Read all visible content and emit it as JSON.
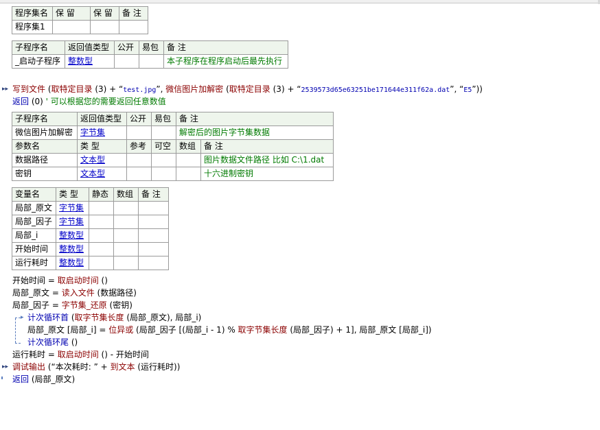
{
  "assembly_table": {
    "headers": [
      "程序集名",
      "保 留",
      "保 留",
      "备 注"
    ],
    "row": [
      "程序集1",
      "",
      "",
      ""
    ]
  },
  "startup_sub_table": {
    "headers": [
      "子程序名",
      "返回值类型",
      "公开",
      "易包",
      "备 注"
    ],
    "row": [
      "_启动子程序",
      "整数型",
      "",
      "",
      "本子程序在程序启动后最先执行"
    ]
  },
  "startup_code": {
    "line1": {
      "p1": "写到文件",
      "p2": " (",
      "p3": "取特定目录",
      "p4": " (3) + “",
      "p5": "test.jpg",
      "p6": "”, ",
      "p7": "微信图片加解密",
      "p8": " (",
      "p9": "取特定目录",
      "p10": " (3) + “",
      "p11": "2539573d65e63251be171644e311f62a.dat",
      "p12": "”, “",
      "p13": "E5",
      "p14": "”))"
    },
    "line2": {
      "p1": "返回",
      "p2": " (0)  ",
      "p3": "' 可以根据您的需要返回任意数值"
    }
  },
  "decrypt_sub_table": {
    "headers": [
      "子程序名",
      "返回值类型",
      "公开",
      "易包",
      "备 注"
    ],
    "row": [
      "微信图片加解密",
      "字节集",
      "",
      "",
      "解密后的图片字节集数据"
    ],
    "param_headers": [
      "参数名",
      "类 型",
      "参考",
      "可空",
      "数组",
      "备 注"
    ],
    "params": [
      [
        "数据路径",
        "文本型",
        "",
        "",
        "",
        "图片数据文件路径 比如 C:\\1.dat"
      ],
      [
        "密钥",
        "文本型",
        "",
        "",
        "",
        "十六进制密钥"
      ]
    ]
  },
  "locals_table": {
    "headers": [
      "变量名",
      "类 型",
      "静态",
      "数组",
      "备 注"
    ],
    "rows": [
      [
        "局部_原文",
        "字节集",
        "",
        "",
        ""
      ],
      [
        "局部_因子",
        "字节集",
        "",
        "",
        ""
      ],
      [
        "局部_i",
        "整数型",
        "",
        "",
        ""
      ],
      [
        "开始时间",
        "整数型",
        "",
        "",
        ""
      ],
      [
        "运行耗时",
        "整数型",
        "",
        "",
        ""
      ]
    ]
  },
  "code": {
    "l1": {
      "a": "开始时间",
      "b": " = ",
      "c": "取启动时间",
      "d": " ()"
    },
    "l2": {
      "a": "局部_原文",
      "b": " = ",
      "c": "读入文件",
      "d": " (数据路径)"
    },
    "l3": {
      "a": "局部_因子",
      "b": " = ",
      "c": "字节集_还原",
      "d": " (密钥)"
    },
    "l4": {
      "a": "计次循环首",
      "b": " (",
      "c": "取字节集长度",
      "d": " (局部_原文), 局部_i)"
    },
    "l5": {
      "a": "局部_原文 [局部_i] = ",
      "b": "位异或",
      "c": " (局部_因子 [(局部_i - 1) % ",
      "d": "取字节集长度",
      "e": " (局部_因子) + 1], 局部_原文 [局部_i])"
    },
    "l6": {
      "a": "计次循环尾",
      "b": " ()"
    },
    "l7": {
      "a": "运行耗时",
      "b": " = ",
      "c": "取启动时间",
      "d": " () - 开始时间"
    },
    "l8": {
      "a": "调试输出",
      "b": " (“本次耗时: ” + ",
      "c": "到文本",
      "d": " (运行耗时))"
    },
    "l9": {
      "a": "返回",
      "b": " (局部_原文)"
    }
  }
}
